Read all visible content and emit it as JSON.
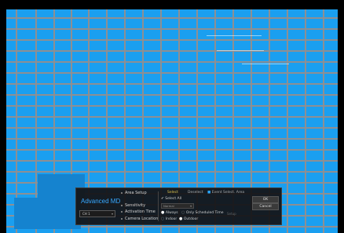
{
  "window": {
    "title": "Advanced MD"
  },
  "channel": {
    "selected": "CH 1",
    "arrow_icon": "chevron-down-icon"
  },
  "labels": {
    "area_setup": "Area Setup",
    "sensitivity": "Sensitivity",
    "activation_time": "Activation Time",
    "camera_location": "Camera Location"
  },
  "area_setup": {
    "select": "Select",
    "deselect": "Deselect",
    "event_select_area": "Event Select. Area",
    "select_all": "Select All"
  },
  "sensitivity": {
    "value": "Normal"
  },
  "activation_time": {
    "always": "Always",
    "only_scheduled_time": "Only Scheduled Time",
    "setup": "Setup",
    "selected": "Always"
  },
  "camera_location": {
    "indoor": "Indoor",
    "outdoor": "Outdoor",
    "selected": "Outdoor"
  },
  "buttons": {
    "ok": "OK",
    "cancel": "Cancel"
  },
  "colors": {
    "view_background": "#1a9ff0",
    "grid_line": "#8d8f93",
    "panel_background": "#141416",
    "title_accent": "#39a8ff",
    "tab_active": "#e8c84a"
  }
}
